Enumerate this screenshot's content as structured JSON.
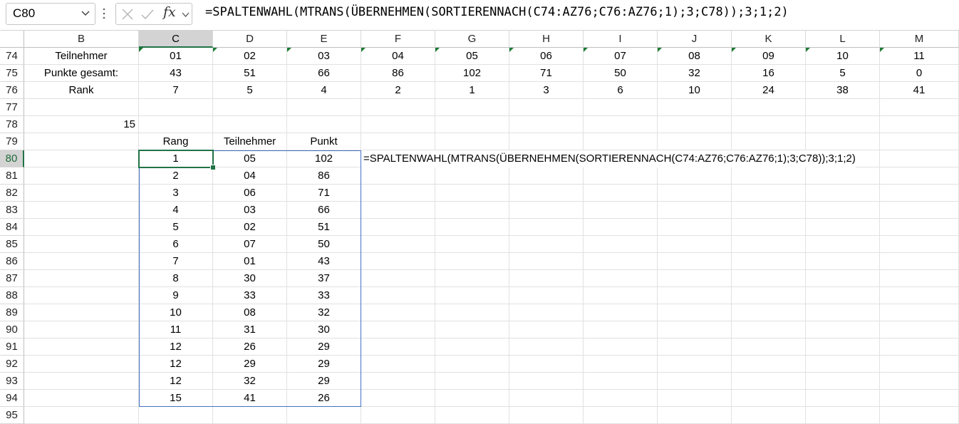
{
  "namebox": {
    "value": "C80"
  },
  "formula_bar": {
    "fx_label": "fx",
    "formula": "=SPALTENWAHL(MTRANS(ÜBERNEHMEN(SORTIERENNACH(C74:AZ76;C76:AZ76;1);3;C78));3;1;2)"
  },
  "columns": [
    "B",
    "C",
    "D",
    "E",
    "F",
    "G",
    "H",
    "I",
    "J",
    "K",
    "L",
    "M"
  ],
  "rows": [
    "74",
    "75",
    "76",
    "77",
    "78",
    "79",
    "80",
    "81",
    "82",
    "83",
    "84",
    "85",
    "86",
    "87",
    "88",
    "89",
    "90",
    "91",
    "92",
    "93",
    "94",
    "95"
  ],
  "selected_col": "C",
  "selected_row": "80",
  "header_rows": {
    "r74": {
      "label": "Teilnehmer",
      "values": [
        "01",
        "02",
        "03",
        "04",
        "05",
        "06",
        "07",
        "08",
        "09",
        "10",
        "11"
      ]
    },
    "r75": {
      "label": "Punkte gesamt:",
      "values": [
        "43",
        "51",
        "66",
        "86",
        "102",
        "71",
        "50",
        "32",
        "16",
        "5",
        "0"
      ]
    },
    "r76": {
      "label": "Rank",
      "values": [
        "7",
        "5",
        "4",
        "2",
        "1",
        "3",
        "6",
        "10",
        "24",
        "38",
        "41"
      ]
    }
  },
  "cell_c78": "15",
  "result_headers": [
    "Rang",
    "Teilnehmer",
    "Punkt"
  ],
  "result_rows": [
    [
      "1",
      "05",
      "102"
    ],
    [
      "2",
      "04",
      "86"
    ],
    [
      "3",
      "06",
      "71"
    ],
    [
      "4",
      "03",
      "66"
    ],
    [
      "5",
      "02",
      "51"
    ],
    [
      "6",
      "07",
      "50"
    ],
    [
      "7",
      "01",
      "43"
    ],
    [
      "8",
      "30",
      "37"
    ],
    [
      "9",
      "33",
      "33"
    ],
    [
      "10",
      "08",
      "32"
    ],
    [
      "11",
      "31",
      "30"
    ],
    [
      "12",
      "26",
      "29"
    ],
    [
      "12",
      "29",
      "29"
    ],
    [
      "12",
      "32",
      "29"
    ],
    [
      "15",
      "41",
      "26"
    ]
  ],
  "formula_text_f80": "=SPALTENWAHL(MTRANS(ÜBERNEHMEN(SORTIERENNACH(C74:AZ76;C76:AZ76;1);3;C78));3;1;2)",
  "colors": {
    "accent_green": "#217346",
    "range_blue": "#4472c4",
    "error_triangle": "#1e7b34"
  },
  "icons": {
    "namebox_dropdown": "chevron-down-icon",
    "cancel": "x-icon",
    "enter": "check-icon",
    "insert_function": "fx-icon"
  }
}
